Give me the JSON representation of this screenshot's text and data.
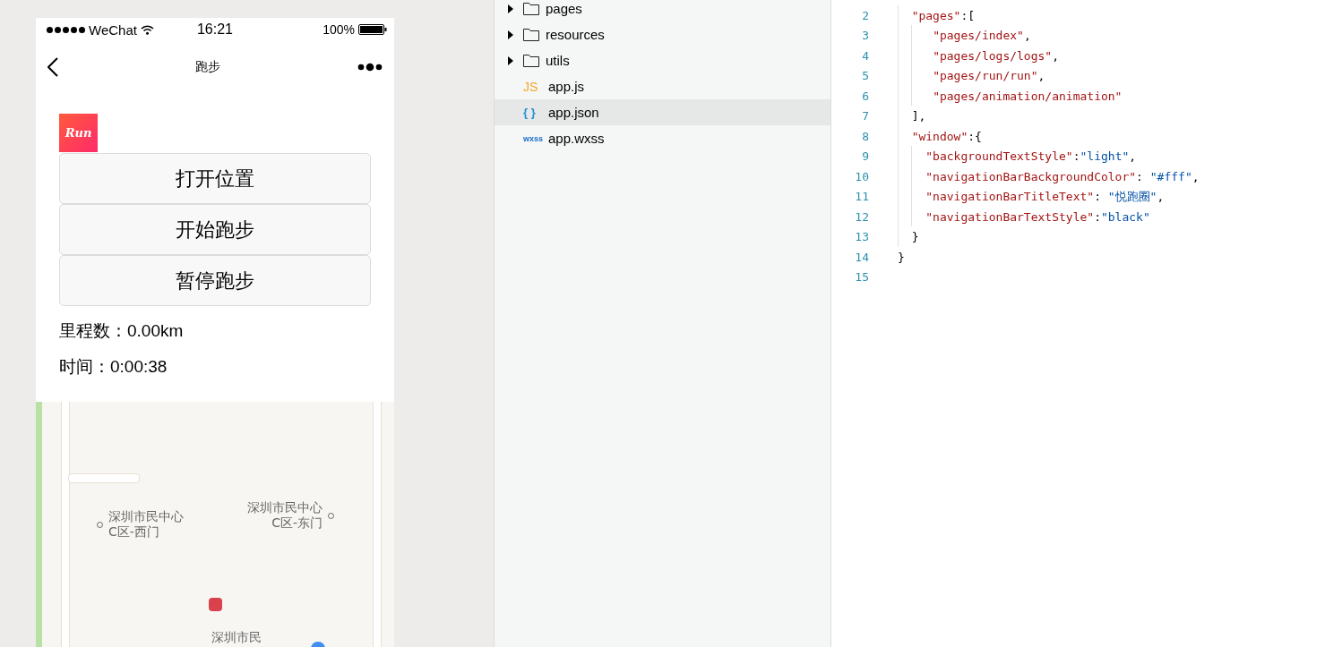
{
  "phone": {
    "status_bar": {
      "carrier": "WeChat",
      "time": "16:21",
      "battery": "100%"
    },
    "nav_bar": {
      "title": "跑步"
    },
    "logo": {
      "text": "Run"
    },
    "buttons": [
      "打开位置",
      "开始跑步",
      "暂停跑步"
    ],
    "stats": [
      "里程数：0.00km",
      "时间：0:00:38"
    ],
    "map": {
      "labels": [
        {
          "lines": [
            "深圳市民中心",
            "C区-西门"
          ],
          "kind": "poi-before"
        },
        {
          "lines": [
            "深圳市民中心",
            "C区-东门"
          ],
          "kind": "poi-after"
        },
        {
          "lines": [
            "深圳市民"
          ],
          "kind": "plain"
        }
      ]
    }
  },
  "file_tree": [
    {
      "name": "pages",
      "kind": "folder",
      "selected": false
    },
    {
      "name": "resources",
      "kind": "folder",
      "selected": false
    },
    {
      "name": "utils",
      "kind": "folder",
      "selected": false
    },
    {
      "name": "app.js",
      "kind": "js",
      "icon_text": "JS",
      "selected": false
    },
    {
      "name": "app.json",
      "kind": "json",
      "icon_text": "{ }",
      "selected": true
    },
    {
      "name": "app.wxss",
      "kind": "wxss",
      "icon_text": "wxss",
      "selected": false
    }
  ],
  "editor": {
    "lines": [
      {
        "number": "2",
        "kind": "outer",
        "tokens": [
          {
            "kind": "key",
            "text": "\"pages\""
          },
          {
            "kind": "punct",
            "text": ":["
          }
        ]
      },
      {
        "number": "3",
        "kind": "nested",
        "tokens": [
          {
            "kind": "key",
            "text": "\"pages/index\""
          },
          {
            "kind": "punct",
            "text": ","
          }
        ]
      },
      {
        "number": "4",
        "kind": "nested",
        "tokens": [
          {
            "kind": "key",
            "text": "\"pages/logs/logs\""
          },
          {
            "kind": "punct",
            "text": ","
          }
        ]
      },
      {
        "number": "5",
        "kind": "nested",
        "tokens": [
          {
            "kind": "key",
            "text": "\"pages/run/run\""
          },
          {
            "kind": "punct",
            "text": ","
          }
        ]
      },
      {
        "number": "6",
        "kind": "nested",
        "tokens": [
          {
            "kind": "key",
            "text": "\"pages/animation/animation\""
          }
        ]
      },
      {
        "number": "7",
        "kind": "outer",
        "tokens": [
          {
            "kind": "punct",
            "text": "],"
          }
        ]
      },
      {
        "number": "8",
        "kind": "outer",
        "tokens": [
          {
            "kind": "key",
            "text": "\"window\""
          },
          {
            "kind": "punct",
            "text": ":{"
          }
        ]
      },
      {
        "number": "9",
        "kind": "inner",
        "tokens": [
          {
            "kind": "key",
            "text": "\"backgroundTextStyle\""
          },
          {
            "kind": "punct",
            "text": ":"
          },
          {
            "kind": "string",
            "text": "\"light\""
          },
          {
            "kind": "punct",
            "text": ","
          }
        ]
      },
      {
        "number": "10",
        "kind": "inner",
        "tokens": [
          {
            "kind": "key",
            "text": "\"navigationBarBackgroundColor\""
          },
          {
            "kind": "punct",
            "text": ":"
          },
          {
            "kind": "string",
            "text": " \"#fff\""
          },
          {
            "kind": "punct",
            "text": ","
          }
        ]
      },
      {
        "number": "11",
        "kind": "inner",
        "tokens": [
          {
            "kind": "key",
            "text": "\"navigationBarTitleText\""
          },
          {
            "kind": "punct",
            "text": ":"
          },
          {
            "kind": "string",
            "text": " \"悦跑圈\""
          },
          {
            "kind": "punct",
            "text": ","
          }
        ]
      },
      {
        "number": "12",
        "kind": "inner",
        "tokens": [
          {
            "kind": "key",
            "text": "\"navigationBarTextStyle\""
          },
          {
            "kind": "punct",
            "text": ":"
          },
          {
            "kind": "string",
            "text": "\"black\""
          }
        ]
      },
      {
        "number": "13",
        "kind": "outer",
        "tokens": [
          {
            "kind": "punct",
            "text": "}"
          }
        ]
      },
      {
        "number": "14",
        "kind": "root",
        "tokens": [
          {
            "kind": "punct",
            "text": "}"
          }
        ]
      },
      {
        "number": "15"
      }
    ]
  }
}
